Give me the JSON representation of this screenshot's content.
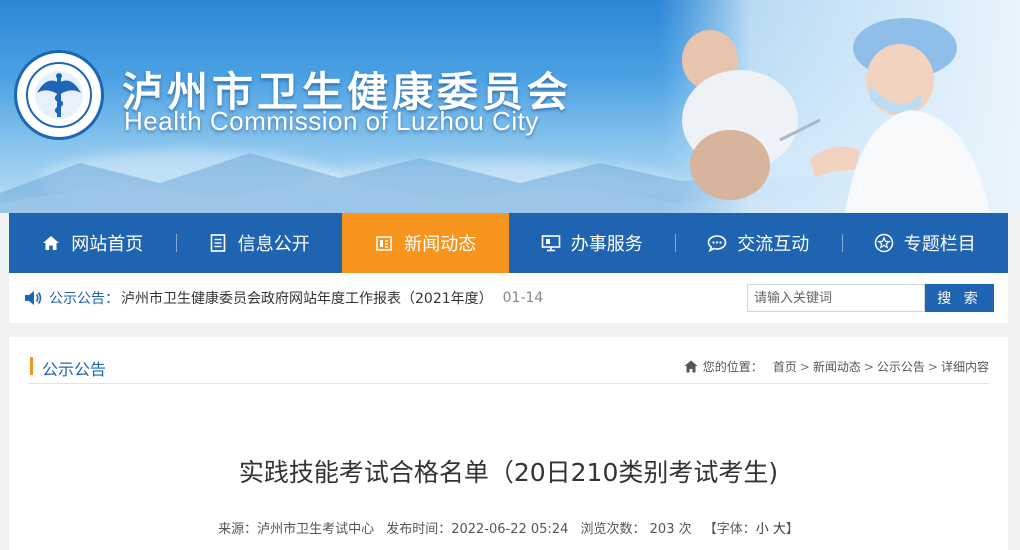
{
  "header": {
    "title_cn": "泸州市卫生健康委员会",
    "title_en": "Health Commission of Luzhou City"
  },
  "nav": {
    "items": [
      {
        "label": "网站首页",
        "icon": "home-icon"
      },
      {
        "label": "信息公开",
        "icon": "document-icon"
      },
      {
        "label": "新闻动态",
        "icon": "news-icon",
        "active": true
      },
      {
        "label": "办事服务",
        "icon": "monitor-icon"
      },
      {
        "label": "交流互动",
        "icon": "chat-icon"
      },
      {
        "label": "专题栏目",
        "icon": "star-icon"
      }
    ]
  },
  "notice": {
    "label": "公示公告：",
    "text": "泸州市卫生健康委员会政府网站年度工作报表（2021年度）",
    "date": "01-14"
  },
  "search": {
    "placeholder": "请输入关键词",
    "button_label": "搜 索"
  },
  "section": {
    "title": "公示公告"
  },
  "breadcrumb": {
    "prefix": "您的位置：",
    "items": [
      "首页",
      "新闻动态",
      "公示公告",
      "详细内容"
    ],
    "separator": ">"
  },
  "article": {
    "title": "实践技能考试合格名单（20日210类别考试考生)",
    "source": "来源：泸州市卫生考试中心",
    "published": "发布时间：2022-06-22 05:24",
    "views": "浏览次数： 203  次",
    "font_prefix": "【字体：",
    "font_small": "小",
    "font_large": "大",
    "font_suffix": "】"
  },
  "colors": {
    "brand_blue": "#1f64b1",
    "active_orange": "#f7941d"
  }
}
